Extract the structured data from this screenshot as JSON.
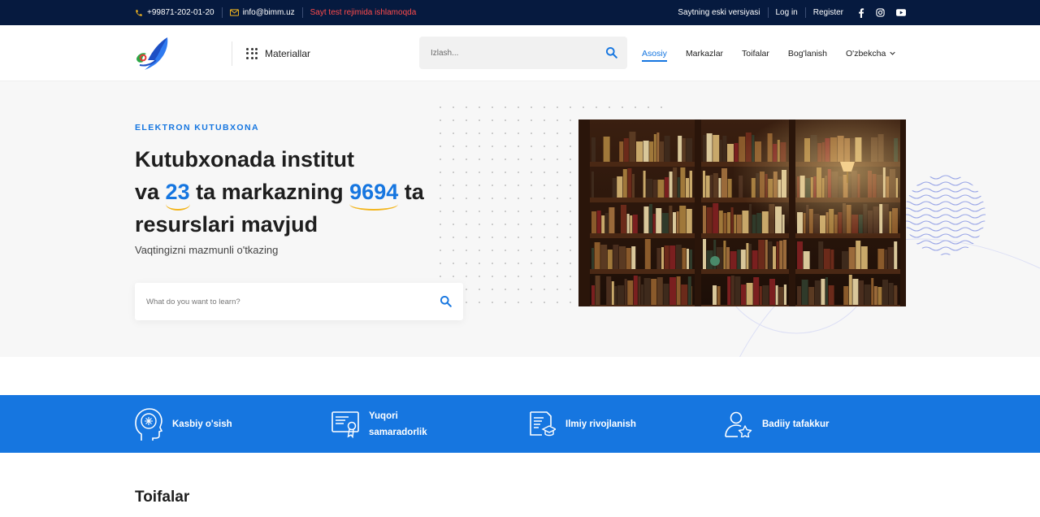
{
  "topbar": {
    "phone": "+99871-202-01-20",
    "email": "info@bimm.uz",
    "notice": "Sayt test rejimida ishlamoqda",
    "old_version": "Saytning eski versiyasi",
    "login": "Log in",
    "register": "Register"
  },
  "header": {
    "materials": "Materiallar",
    "search_placeholder": "Izlash...",
    "nav": [
      "Asosiy",
      "Markazlar",
      "Toifalar",
      "Bog'lanish"
    ],
    "language": "O'zbekcha"
  },
  "hero": {
    "eyebrow": "ELEKTRON KUTUBXONA",
    "title_1": "Kutubxonada institut",
    "title_2a": "va ",
    "count_centers": "23",
    "title_2b": " ta markazning ",
    "count_resources": "9694",
    "title_2c": " ta",
    "title_3": "resurslari mavjud",
    "subtitle": "Vaqtingizni mazmunli o'tkazing",
    "search_placeholder": "What do you want to learn?"
  },
  "features": [
    {
      "label": "Kasbiy o'sish"
    },
    {
      "label_1": "Yuqori",
      "label_2": "samaradorlik"
    },
    {
      "label": "Ilmiy rivojlanish"
    },
    {
      "label": "Badiiy tafakkur"
    }
  ],
  "sections": {
    "categories_title": "Toifalar"
  },
  "colors": {
    "accent": "#1676e0",
    "topbar": "#061a3f",
    "warning": "#ff4b4b",
    "underline": "#f3b61f"
  }
}
